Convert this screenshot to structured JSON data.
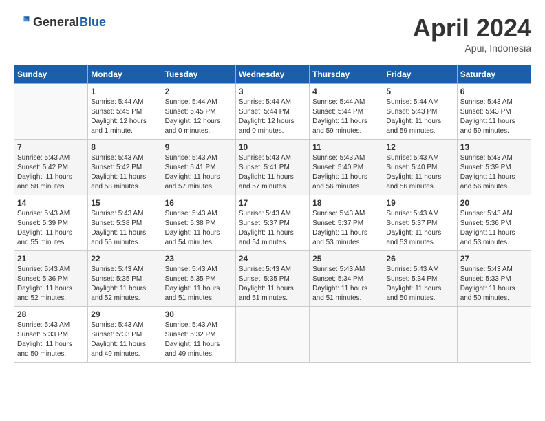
{
  "header": {
    "logo_general": "General",
    "logo_blue": "Blue",
    "month": "April 2024",
    "location": "Apui, Indonesia"
  },
  "days_of_week": [
    "Sunday",
    "Monday",
    "Tuesday",
    "Wednesday",
    "Thursday",
    "Friday",
    "Saturday"
  ],
  "weeks": [
    [
      {
        "day": "",
        "sunrise": "",
        "sunset": "",
        "daylight": ""
      },
      {
        "day": "1",
        "sunrise": "Sunrise: 5:44 AM",
        "sunset": "Sunset: 5:45 PM",
        "daylight": "Daylight: 12 hours and 1 minute."
      },
      {
        "day": "2",
        "sunrise": "Sunrise: 5:44 AM",
        "sunset": "Sunset: 5:45 PM",
        "daylight": "Daylight: 12 hours and 0 minutes."
      },
      {
        "day": "3",
        "sunrise": "Sunrise: 5:44 AM",
        "sunset": "Sunset: 5:44 PM",
        "daylight": "Daylight: 12 hours and 0 minutes."
      },
      {
        "day": "4",
        "sunrise": "Sunrise: 5:44 AM",
        "sunset": "Sunset: 5:44 PM",
        "daylight": "Daylight: 11 hours and 59 minutes."
      },
      {
        "day": "5",
        "sunrise": "Sunrise: 5:44 AM",
        "sunset": "Sunset: 5:43 PM",
        "daylight": "Daylight: 11 hours and 59 minutes."
      },
      {
        "day": "6",
        "sunrise": "Sunrise: 5:43 AM",
        "sunset": "Sunset: 5:43 PM",
        "daylight": "Daylight: 11 hours and 59 minutes."
      }
    ],
    [
      {
        "day": "7",
        "sunrise": "Sunrise: 5:43 AM",
        "sunset": "Sunset: 5:42 PM",
        "daylight": "Daylight: 11 hours and 58 minutes."
      },
      {
        "day": "8",
        "sunrise": "Sunrise: 5:43 AM",
        "sunset": "Sunset: 5:42 PM",
        "daylight": "Daylight: 11 hours and 58 minutes."
      },
      {
        "day": "9",
        "sunrise": "Sunrise: 5:43 AM",
        "sunset": "Sunset: 5:41 PM",
        "daylight": "Daylight: 11 hours and 57 minutes."
      },
      {
        "day": "10",
        "sunrise": "Sunrise: 5:43 AM",
        "sunset": "Sunset: 5:41 PM",
        "daylight": "Daylight: 11 hours and 57 minutes."
      },
      {
        "day": "11",
        "sunrise": "Sunrise: 5:43 AM",
        "sunset": "Sunset: 5:40 PM",
        "daylight": "Daylight: 11 hours and 56 minutes."
      },
      {
        "day": "12",
        "sunrise": "Sunrise: 5:43 AM",
        "sunset": "Sunset: 5:40 PM",
        "daylight": "Daylight: 11 hours and 56 minutes."
      },
      {
        "day": "13",
        "sunrise": "Sunrise: 5:43 AM",
        "sunset": "Sunset: 5:39 PM",
        "daylight": "Daylight: 11 hours and 56 minutes."
      }
    ],
    [
      {
        "day": "14",
        "sunrise": "Sunrise: 5:43 AM",
        "sunset": "Sunset: 5:39 PM",
        "daylight": "Daylight: 11 hours and 55 minutes."
      },
      {
        "day": "15",
        "sunrise": "Sunrise: 5:43 AM",
        "sunset": "Sunset: 5:38 PM",
        "daylight": "Daylight: 11 hours and 55 minutes."
      },
      {
        "day": "16",
        "sunrise": "Sunrise: 5:43 AM",
        "sunset": "Sunset: 5:38 PM",
        "daylight": "Daylight: 11 hours and 54 minutes."
      },
      {
        "day": "17",
        "sunrise": "Sunrise: 5:43 AM",
        "sunset": "Sunset: 5:37 PM",
        "daylight": "Daylight: 11 hours and 54 minutes."
      },
      {
        "day": "18",
        "sunrise": "Sunrise: 5:43 AM",
        "sunset": "Sunset: 5:37 PM",
        "daylight": "Daylight: 11 hours and 53 minutes."
      },
      {
        "day": "19",
        "sunrise": "Sunrise: 5:43 AM",
        "sunset": "Sunset: 5:37 PM",
        "daylight": "Daylight: 11 hours and 53 minutes."
      },
      {
        "day": "20",
        "sunrise": "Sunrise: 5:43 AM",
        "sunset": "Sunset: 5:36 PM",
        "daylight": "Daylight: 11 hours and 53 minutes."
      }
    ],
    [
      {
        "day": "21",
        "sunrise": "Sunrise: 5:43 AM",
        "sunset": "Sunset: 5:36 PM",
        "daylight": "Daylight: 11 hours and 52 minutes."
      },
      {
        "day": "22",
        "sunrise": "Sunrise: 5:43 AM",
        "sunset": "Sunset: 5:35 PM",
        "daylight": "Daylight: 11 hours and 52 minutes."
      },
      {
        "day": "23",
        "sunrise": "Sunrise: 5:43 AM",
        "sunset": "Sunset: 5:35 PM",
        "daylight": "Daylight: 11 hours and 51 minutes."
      },
      {
        "day": "24",
        "sunrise": "Sunrise: 5:43 AM",
        "sunset": "Sunset: 5:35 PM",
        "daylight": "Daylight: 11 hours and 51 minutes."
      },
      {
        "day": "25",
        "sunrise": "Sunrise: 5:43 AM",
        "sunset": "Sunset: 5:34 PM",
        "daylight": "Daylight: 11 hours and 51 minutes."
      },
      {
        "day": "26",
        "sunrise": "Sunrise: 5:43 AM",
        "sunset": "Sunset: 5:34 PM",
        "daylight": "Daylight: 11 hours and 50 minutes."
      },
      {
        "day": "27",
        "sunrise": "Sunrise: 5:43 AM",
        "sunset": "Sunset: 5:33 PM",
        "daylight": "Daylight: 11 hours and 50 minutes."
      }
    ],
    [
      {
        "day": "28",
        "sunrise": "Sunrise: 5:43 AM",
        "sunset": "Sunset: 5:33 PM",
        "daylight": "Daylight: 11 hours and 50 minutes."
      },
      {
        "day": "29",
        "sunrise": "Sunrise: 5:43 AM",
        "sunset": "Sunset: 5:33 PM",
        "daylight": "Daylight: 11 hours and 49 minutes."
      },
      {
        "day": "30",
        "sunrise": "Sunrise: 5:43 AM",
        "sunset": "Sunset: 5:32 PM",
        "daylight": "Daylight: 11 hours and 49 minutes."
      },
      {
        "day": "",
        "sunrise": "",
        "sunset": "",
        "daylight": ""
      },
      {
        "day": "",
        "sunrise": "",
        "sunset": "",
        "daylight": ""
      },
      {
        "day": "",
        "sunrise": "",
        "sunset": "",
        "daylight": ""
      },
      {
        "day": "",
        "sunrise": "",
        "sunset": "",
        "daylight": ""
      }
    ]
  ]
}
